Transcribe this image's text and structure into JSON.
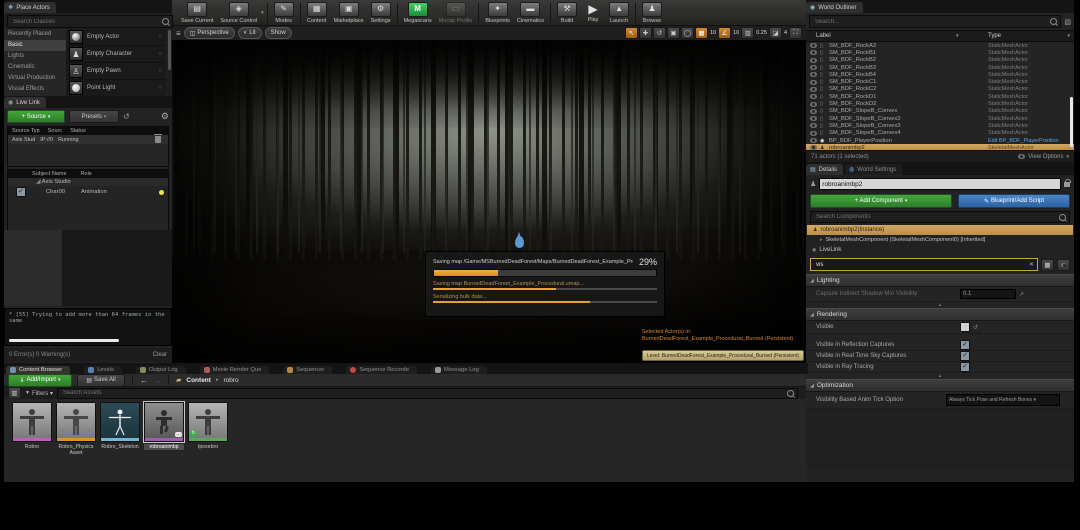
{
  "main_toolbar": {
    "buttons": [
      {
        "label": "Save Current"
      },
      {
        "label": "Source Control",
        "caret": "▾"
      },
      {
        "label": "Modes",
        "caret": "▾"
      },
      {
        "label": "Content"
      },
      {
        "label": "Marketplace"
      },
      {
        "label": "Settings",
        "caret": "▾"
      },
      {
        "label": "Megascans",
        "icon_letter": "M"
      },
      {
        "label": "Mocap Profile",
        "caret": "▾"
      },
      {
        "label": "Blueprints",
        "caret": "▾"
      },
      {
        "label": "Cinematics",
        "caret": "▾"
      },
      {
        "label": "Build",
        "caret": "▾"
      },
      {
        "label": "Play",
        "caret": "▾"
      },
      {
        "label": "Launch",
        "caret": "▾"
      },
      {
        "label": "Browse",
        "caret": "▾"
      }
    ]
  },
  "viewport": {
    "menu_icon": "≡",
    "perspective": "Perspective",
    "lit": "Lit",
    "show": "Show",
    "snap_grid_value": "10",
    "snap_angle_value": "10",
    "snap_scale_value": "0.25",
    "camera_speed_value": "4",
    "selected_note_line1": "Selected Actor(s) in:",
    "selected_note_line2": "BurnedDeadForest_Example_Procedural_Burned (Persistent)",
    "level_button": "Level:  BurnedDeadForest_Example_Procedural_Burned (Persistent)"
  },
  "save_dialog": {
    "title": "Saving map /Game/MSBurnedDeadForest/Maps/BurnedDeadForest_Example_Procedural",
    "percent": "29%",
    "progress_main": 29,
    "sub1_label": "Saving map BurnedDeadForest_Example_Procedural.umap...",
    "sub1_progress": 55,
    "sub2_label": "Serializing bulk data...",
    "sub2_progress": 70
  },
  "place_actors": {
    "tab": "Place Actors",
    "search_placeholder": "Search Classes",
    "categories": [
      "Recently Placed",
      "Basic",
      "Lights",
      "Cinematic",
      "Virtual Production",
      "Visual Effects"
    ],
    "active_category": "Basic",
    "items": [
      "Empty Actor",
      "Empty Character",
      "Empty Pawn",
      "Point Light"
    ]
  },
  "live_link": {
    "tab": "Live Link",
    "source_button": "+ Source",
    "presets_button": "Presets",
    "source_headers": [
      "Source Typ",
      "Sourc",
      "Status"
    ],
    "source_row": {
      "type": "Axis Stud",
      "machine": "IP://0",
      "status": "Running"
    },
    "subject_headers": [
      "Subject Name",
      "Role"
    ],
    "subject_group": "Axis Studio",
    "subject_row": {
      "name": "Char00",
      "role": "Animation"
    }
  },
  "stats_log": {
    "line": "* [55] Trying to add more than 64 frames in the same",
    "footer_left": "0 Error(s)  0 Warning(s)",
    "clear": "Clear"
  },
  "outliner": {
    "tab": "World Outliner",
    "search_placeholder": "Search...",
    "col_label": "Label",
    "col_type": "Type",
    "rows": [
      {
        "label": "SM_BDF_RockA3",
        "type": "StaticMeshActor"
      },
      {
        "label": "SM_BDF_RockB1",
        "type": "StaticMeshActor"
      },
      {
        "label": "SM_BDF_RockB2",
        "type": "StaticMeshActor"
      },
      {
        "label": "SM_BDF_RockB3",
        "type": "StaticMeshActor"
      },
      {
        "label": "SM_BDF_RockB4",
        "type": "StaticMeshActor"
      },
      {
        "label": "SM_BDF_RockC1",
        "type": "StaticMeshActor"
      },
      {
        "label": "SM_BDF_RockC2",
        "type": "StaticMeshActor"
      },
      {
        "label": "SM_BDF_RockD1",
        "type": "StaticMeshActor"
      },
      {
        "label": "SM_BDF_RockD2",
        "type": "StaticMeshActor"
      },
      {
        "label": "SM_BDF_SlopeB_Convex",
        "type": "StaticMeshActor"
      },
      {
        "label": "SM_BDF_SlopeB_Convex2",
        "type": "StaticMeshActor"
      },
      {
        "label": "SM_BDF_SlopeB_Convex3",
        "type": "StaticMeshActor"
      },
      {
        "label": "SM_BDF_SlopeB_Convex4",
        "type": "StaticMeshActor"
      },
      {
        "label": "BP_BDF_PlayerPosition",
        "type": "Edit BP_BDF_PlayerPosition"
      },
      {
        "label": "robroanimbp2",
        "type": "SkeletalMeshActor"
      }
    ],
    "footer": "71 actors (1 selected)",
    "view_options": "View Options"
  },
  "details": {
    "tab_details": "Details",
    "tab_world_settings": "World Settings",
    "name_value": "robroanimbp2",
    "add_component": "+ Add Component",
    "blueprint_add_script": "Blueprint/Add Script",
    "search_components_placeholder": "Search Components",
    "component_root": "robroanimbp2(Instance)",
    "component_child": "SkeletalMeshComponent (SkeletalMeshComponent0) [Inherited]",
    "component_livelink": "LiveLink",
    "filter_value": "vis",
    "lighting_title": "Lighting",
    "lighting_label": "Capsule Indirect Shadow Min Visibility",
    "lighting_value": "0.1",
    "rendering_title": "Rendering",
    "rendering_rows": [
      {
        "label": "Visible",
        "mark": ""
      },
      {
        "label": "Visible in Reflection Captures",
        "mark": "✓"
      },
      {
        "label": "Visible in Real Time Sky Captures",
        "mark": "✓"
      },
      {
        "label": "Visible in Ray Tracing",
        "mark": "✓"
      }
    ],
    "optimization_title": "Optimization",
    "optimization_label": "Visibility Based Anim Tick Option",
    "optimization_value": "Always Tick Pose and Refresh Bones ▾"
  },
  "bottom_tabs": [
    {
      "label": "Content Browser"
    },
    {
      "label": "Levels"
    },
    {
      "label": "Output Log"
    },
    {
      "label": "Movie Render Que"
    },
    {
      "label": "Sequencer"
    },
    {
      "label": "Sequence Recorde"
    },
    {
      "label": "Message Log"
    }
  ],
  "content_browser": {
    "add_import": "Add/Import",
    "save_all": "Save All",
    "breadcrumb_root": "Content",
    "breadcrumb_sep": "▸",
    "breadcrumb_current": "robro",
    "filters": "Filters ▾",
    "search_placeholder": "Search Assets",
    "assets": [
      {
        "name": "Robro"
      },
      {
        "name": "Robro_Physics Asset"
      },
      {
        "name": "Robro_Skeleton"
      },
      {
        "name": "robroanimbp"
      },
      {
        "name": "tposebro"
      }
    ]
  },
  "colors": {
    "accent_orange": "#e8a33d",
    "selection_tan": "#c79c57",
    "button_green": "#36a632",
    "button_blue": "#3573b5",
    "link_blue": "#57a1e8",
    "megascans_green": "#2fae4f"
  }
}
